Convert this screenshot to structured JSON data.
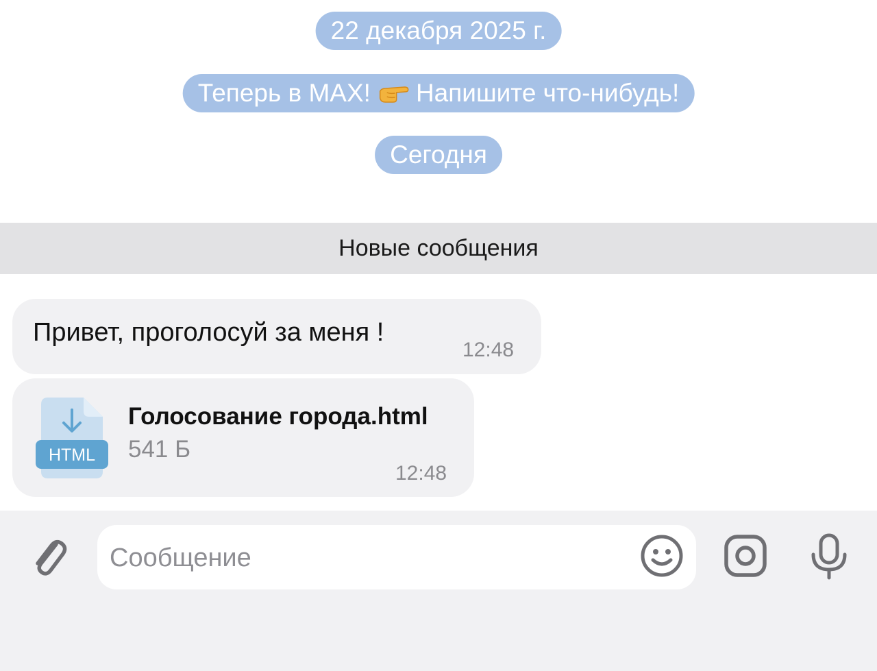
{
  "chat": {
    "date_pill": "22 декабря 2025 г.",
    "welcome_pill": {
      "before": "Теперь в MAX!",
      "after": "Напишите что-нибудь!",
      "icon": "pointing-hand-icon"
    },
    "today_pill": "Сегодня",
    "new_messages_divider": "Новые сообщения",
    "messages": [
      {
        "text": "Привет, проголосуй за меня !",
        "time": "12:48"
      },
      {
        "file": {
          "name": "Голосование города.html",
          "size": "541 Б",
          "badge": "HTML",
          "icon": "download-arrow-icon"
        },
        "time": "12:48"
      }
    ]
  },
  "composer": {
    "placeholder": "Сообщение",
    "value": "",
    "icons": [
      "paperclip-icon",
      "emoji-icon",
      "camera-icon",
      "microphone-icon"
    ]
  },
  "colors": {
    "pill_bg": "#a6c1e6",
    "bubble_bg": "#f1f1f3",
    "divider_bg": "#e2e2e4",
    "file_icon_light": "#c9def0",
    "file_icon_badge": "#5fa4d1",
    "icon_gray": "#6f6f73"
  }
}
